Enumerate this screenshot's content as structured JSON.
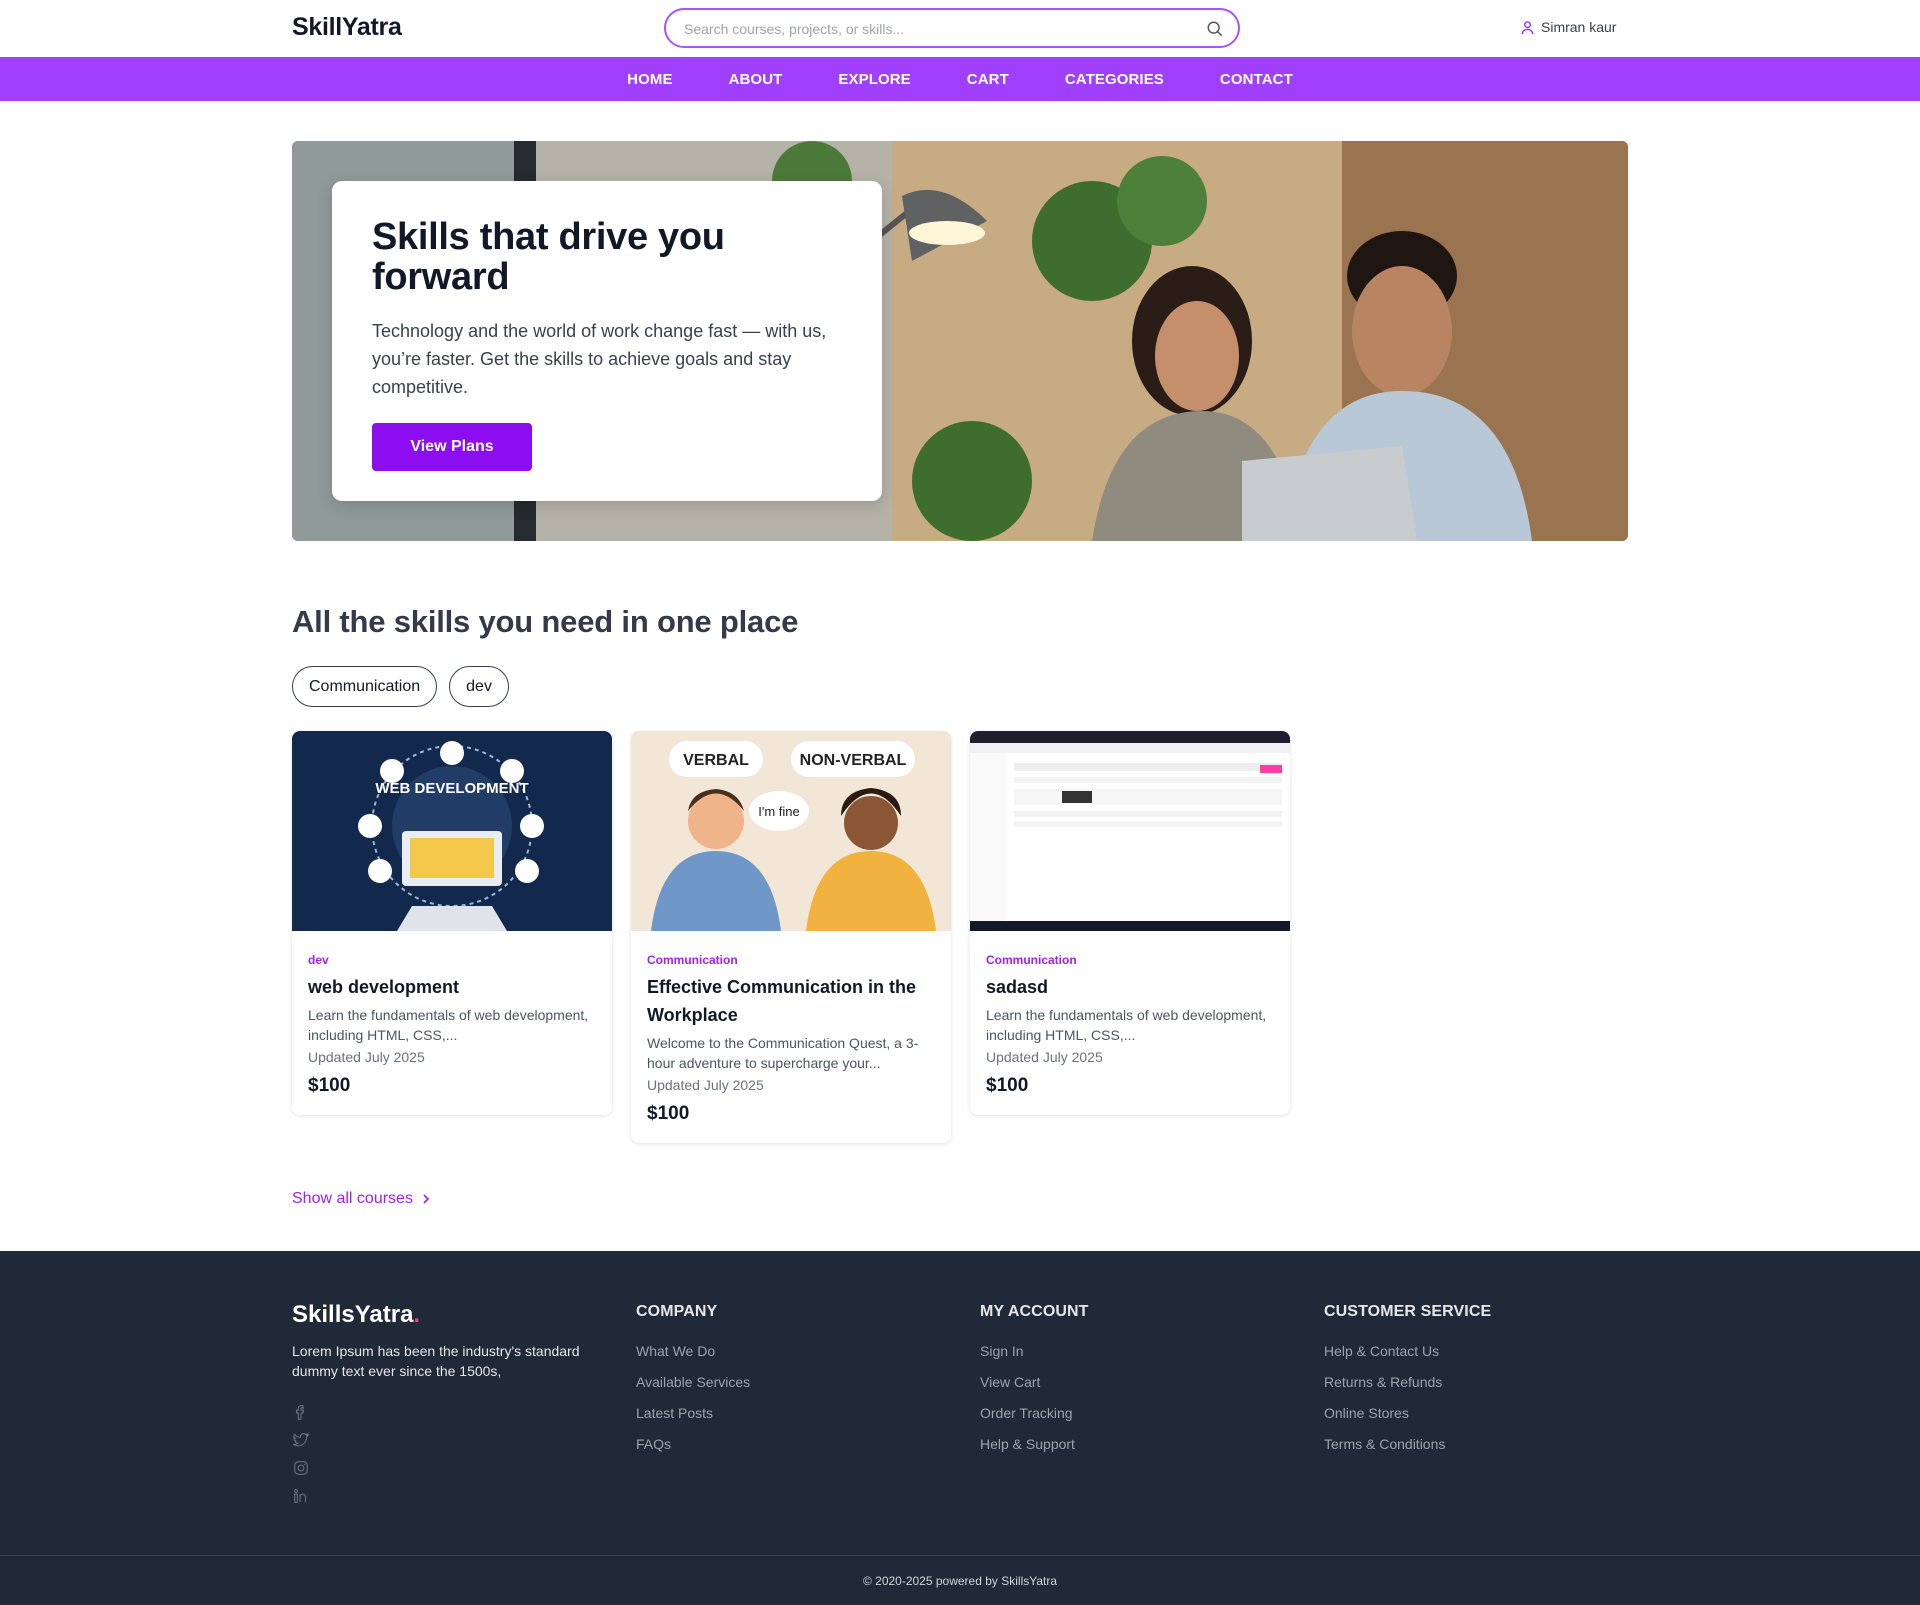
{
  "header": {
    "logo": "SkillYatra",
    "search_placeholder": "Search courses, projects, or skills...",
    "user_name": "Simran kaur"
  },
  "nav": [
    "HOME",
    "ABOUT",
    "EXPLORE",
    "CART",
    "CATEGORIES",
    "CONTACT"
  ],
  "hero": {
    "title": "Skills that drive you forward",
    "text": "Technology and the world of work change fast — with us, you’re faster. Get the skills to achieve goals and stay competitive.",
    "button": "View Plans"
  },
  "skills": {
    "title": "All the skills you need in one place",
    "chips": [
      "Communication",
      "dev"
    ],
    "courses": [
      {
        "category": "dev",
        "title": "web development",
        "description": "Learn the fundamentals of web development, including HTML, CSS,...",
        "updated": "Updated July 2025",
        "price": "$100",
        "image_text": "WEB DEVELOPMENT"
      },
      {
        "category": "Communication",
        "title": "Effective Communication in the Workplace",
        "description": "Welcome to the Communication Quest, a 3-hour adventure to supercharge your...",
        "updated": "Updated July 2025",
        "price": "$100",
        "image_text_1": "VERBAL",
        "image_text_2": "NON-VERBAL",
        "image_text_3": "I'm fine"
      },
      {
        "category": "Communication",
        "title": "sadasd",
        "description": "Learn the fundamentals of web development, including HTML, CSS,...",
        "updated": "Updated July 2025",
        "price": "$100"
      }
    ],
    "show_all": "Show all courses"
  },
  "footer": {
    "logo": "SkillsYatra",
    "logo_dot": ".",
    "about": "Lorem Ipsum has been the industry's standard dummy text ever since the 1500s,",
    "columns": [
      {
        "title": "COMPANY",
        "links": [
          "What We Do",
          "Available Services",
          "Latest Posts",
          "FAQs"
        ]
      },
      {
        "title": "MY ACCOUNT",
        "links": [
          "Sign In",
          "View Cart",
          "Order Tracking",
          "Help & Support"
        ]
      },
      {
        "title": "CUSTOMER SERVICE",
        "links": [
          "Help & Contact Us",
          "Returns & Refunds",
          "Online Stores",
          "Terms & Conditions"
        ]
      }
    ],
    "copyright": "© 2020-2025 powered by SkillsYatra"
  },
  "colors": {
    "accent": "#a13fff",
    "button": "#8b0df0",
    "category": "#a020f0",
    "footer_bg": "#1f2937"
  }
}
